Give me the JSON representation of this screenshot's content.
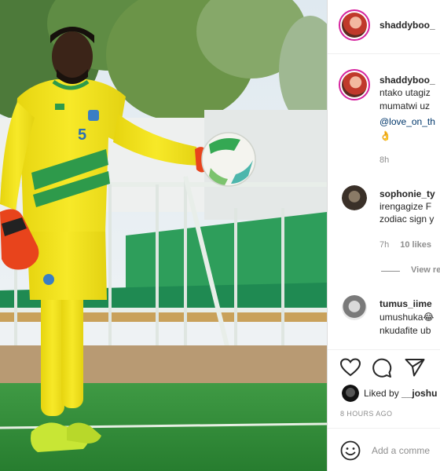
{
  "post": {
    "header": {
      "username": "shaddyboo_"
    },
    "caption": {
      "username": "shaddyboo_",
      "lines": [
        "ntako utagiz",
        "mumatwi uz"
      ],
      "mention": "@love_on_th",
      "emoji": "👌",
      "time": "8h"
    },
    "comments": [
      {
        "username": "sophonie_ty",
        "lines": [
          "irengagize F",
          "zodiac sign y"
        ],
        "time": "7h",
        "likes": "10 likes",
        "view_replies": "View re"
      },
      {
        "username": "tumus_iime",
        "lines": [
          "umushuka😂",
          "nkudafite ub"
        ]
      }
    ],
    "liked_by_prefix": "Liked by",
    "liked_by_user": "__joshu",
    "timestamp": "8 HOURS AGO",
    "add_comment_placeholder": "Add a comme"
  },
  "photo": {
    "jersey_number": "5",
    "colors": {
      "kit": "#f3e21b",
      "kit_stripe": "#2e9a4b",
      "glove": "#e8441c",
      "boots": "#c8e635",
      "pitch": "#2f8a3a"
    }
  },
  "icons": {
    "like": "heart-icon",
    "comment": "comment-icon",
    "share": "share-icon",
    "emoji": "emoji-icon"
  }
}
